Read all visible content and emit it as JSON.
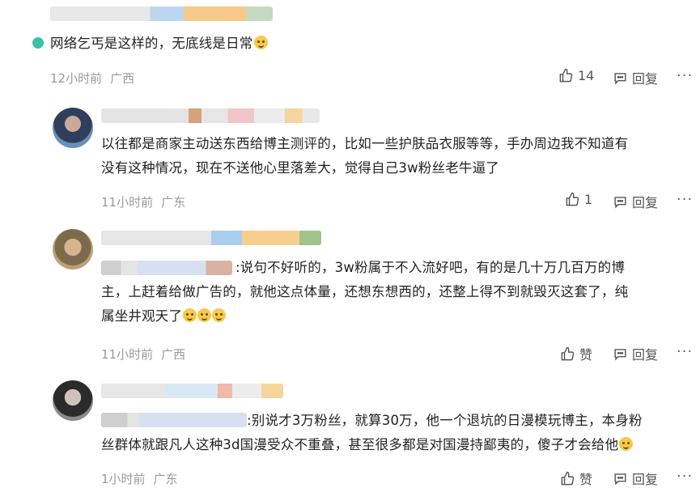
{
  "comments": [
    {
      "text": "网络乞丐是这样的，无底线是日常",
      "time": "12小时前",
      "location": "广西",
      "like_label": "14",
      "reply_label": "回复"
    },
    {
      "text_line1": "以往都是商家主动送东西给博主测评的，比如一些护肤品衣服等等，手办周边我不知道有",
      "text_line2": "没有这种情况，现在不送他心里落差大，觉得自己3w粉丝老牛逼了",
      "time": "11小时前",
      "location": "广东",
      "like_label": "1",
      "reply_label": "回复"
    },
    {
      "text_line1": ":说句不好听的，3w粉属于不入流好吧，有的是几十万几百万的博",
      "text_line2": "主，上赶着给做广告的，就他这点体量，还想东想西的，还整上得不到就毁灭这套了，纯",
      "text_line3": "属坐井观天了",
      "time": "11小时前",
      "location": "广西",
      "like_label": "赞",
      "reply_label": "回复"
    },
    {
      "text_line1": ":别说才3万粉丝，就算30万，他一个退坑的日漫模玩博主，本身粉",
      "text_line2": "丝群体就跟凡人这种3d国漫受众不重叠，甚至很多都是对国漫持鄙夷的，傻子才会给他",
      "time": "1小时前",
      "location": "广东",
      "like_label": "赞",
      "reply_label": "回复"
    }
  ],
  "more_label": "···",
  "colors": {
    "meta": "#9a9a9a",
    "text": "#222222",
    "emoji": "#f7c948",
    "badge": "#3cc2a6"
  }
}
